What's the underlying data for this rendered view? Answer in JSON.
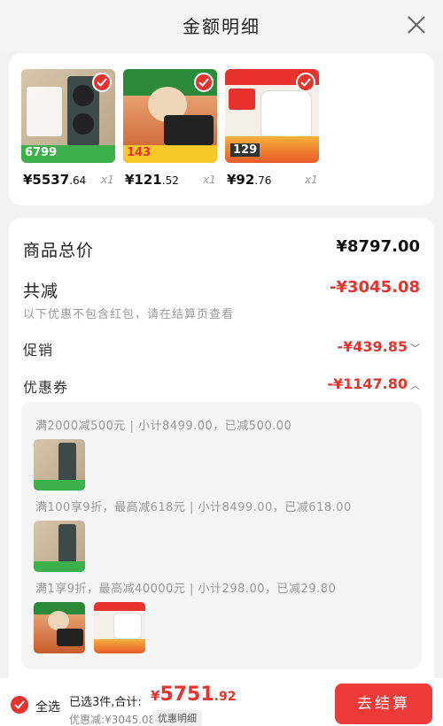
{
  "header": {
    "title": "金额明细",
    "close_icon": "close-icon"
  },
  "products": [
    {
      "price_int": "¥5537",
      "price_dec": ".64",
      "qty": "x1",
      "thumb_colors": [
        "#3d4a47",
        "#c8b59a",
        "#3cb04a"
      ],
      "thumb_text": "6799"
    },
    {
      "price_int": "¥121",
      "price_dec": ".52",
      "qty": "x1",
      "thumb_colors": [
        "#2a8a3a",
        "#f0d6b8",
        "#e85a2a"
      ],
      "thumb_text": "143"
    },
    {
      "price_int": "¥92",
      "price_dec": ".76",
      "qty": "x1",
      "thumb_colors": [
        "#f4efe8",
        "#ffffff",
        "#e8322d"
      ],
      "thumb_text": "129"
    }
  ],
  "summary": {
    "total_label": "商品总价",
    "total_value": "¥8797.00",
    "discount_label": "共减",
    "discount_value": "-¥3045.08",
    "discount_note": "以下优惠不包含红包，请在结算页查看",
    "promo_label": "促销",
    "promo_value": "-¥439.85",
    "coupon_label": "优惠券",
    "coupon_value": "-¥1147.80"
  },
  "coupons": [
    {
      "text": "满2000减500元 | 小计8499.00，已减500.00"
    },
    {
      "text": "满100享9折，最高减618元 | 小计8499.00，已减618.00"
    },
    {
      "text": "满1享9折，最高减40000元 | 小计298.00，已减29.80"
    }
  ],
  "bottom": {
    "select_all": "全选",
    "selected_info": "已选3件,合计:",
    "total_sym": "¥",
    "total_int": "5751",
    "total_dec": ".92",
    "discount_info": "优惠减:¥3045.08",
    "detail_button": "优惠明细",
    "checkout_button": "去结算"
  },
  "colors": {
    "accent": "#e8322d",
    "checkout": "#ef3a3a"
  }
}
